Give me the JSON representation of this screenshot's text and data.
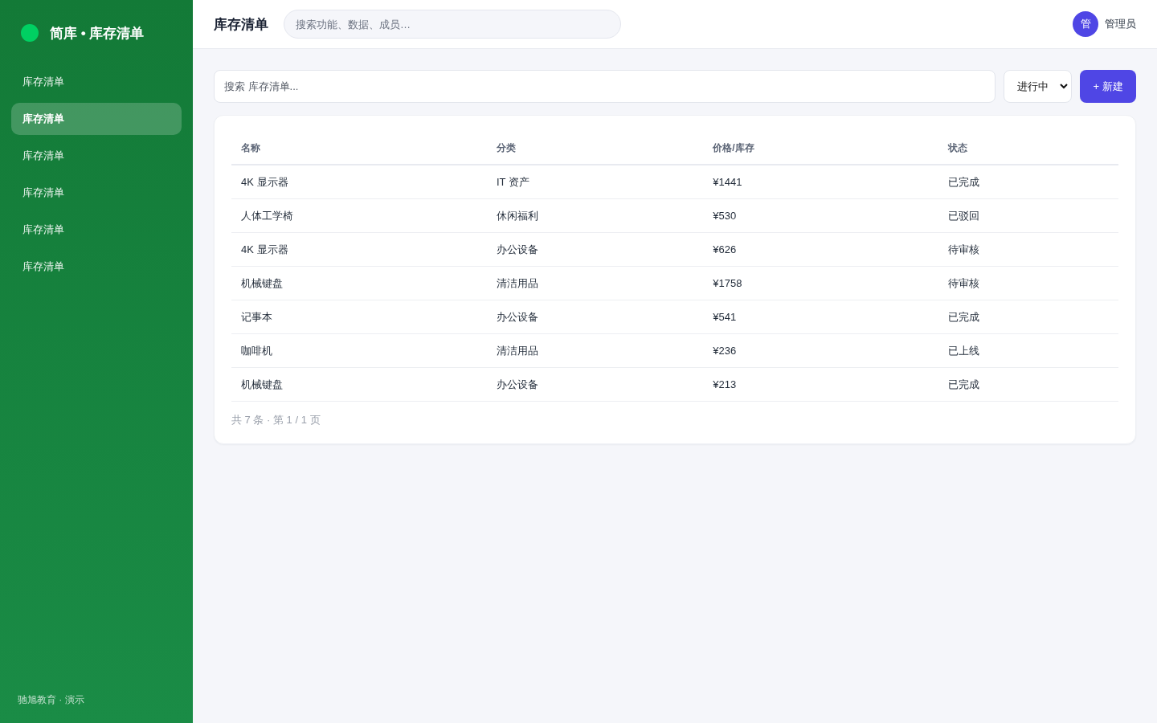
{
  "sidebar": {
    "brand": "简库 • 库存清单",
    "items": [
      {
        "label": "库存清单",
        "selected": false
      },
      {
        "label": "库存清单",
        "selected": true
      },
      {
        "label": "库存清单",
        "selected": false
      },
      {
        "label": "库存清单",
        "selected": false
      },
      {
        "label": "库存清单",
        "selected": false
      },
      {
        "label": "库存清单",
        "selected": false
      }
    ],
    "footer": "驰旭教育 · 演示"
  },
  "topbar": {
    "title": "库存清单",
    "search": {
      "placeholder": "搜索功能、数据、成员…"
    },
    "user": {
      "avatar": "管",
      "name": "管理员"
    }
  },
  "toolbar": {
    "search": {
      "placeholder": "搜索 库存清单..."
    },
    "filter": {
      "value": "进行中"
    },
    "new_button": "+ 新建"
  },
  "table": {
    "columns": [
      "名称",
      "分类",
      "价格/库存",
      "状态"
    ],
    "rows": [
      [
        "4K 显示器",
        "IT 资产",
        "¥1441",
        "已完成"
      ],
      [
        "人体工学椅",
        "休闲福利",
        "¥530",
        "已驳回"
      ],
      [
        "4K 显示器",
        "办公设备",
        "¥626",
        "待审核"
      ],
      [
        "机械键盘",
        "清洁用品",
        "¥1758",
        "待审核"
      ],
      [
        "记事本",
        "办公设备",
        "¥541",
        "已完成"
      ],
      [
        "咖啡机",
        "清洁用品",
        "¥236",
        "已上线"
      ],
      [
        "机械键盘",
        "办公设备",
        "¥213",
        "已完成"
      ]
    ],
    "pagination": "共 7 条 · 第 1 / 1 页"
  }
}
